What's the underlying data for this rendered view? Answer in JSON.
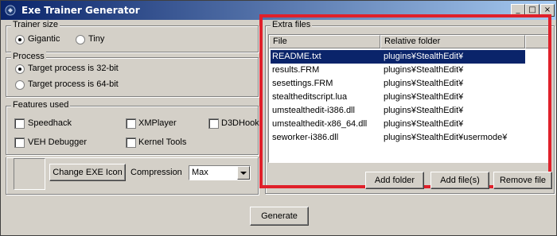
{
  "window": {
    "title": "Exe Trainer Generator"
  },
  "trainer_size": {
    "label": "Trainer size",
    "options": [
      {
        "label": "Gigantic",
        "selected": true
      },
      {
        "label": "Tiny",
        "selected": false
      }
    ]
  },
  "process": {
    "label": "Process",
    "options": [
      {
        "label": "Target process is 32-bit",
        "selected": true
      },
      {
        "label": "Target process is 64-bit",
        "selected": false
      }
    ]
  },
  "features": {
    "label": "Features used",
    "items": [
      {
        "label": "Speedhack",
        "checked": false
      },
      {
        "label": "XMPlayer",
        "checked": false
      },
      {
        "label": "D3DHook",
        "checked": false
      },
      {
        "label": "VEH Debugger",
        "checked": false
      },
      {
        "label": "Kernel Tools",
        "checked": false
      }
    ]
  },
  "icon_area": {
    "change_icon_label": "Change EXE Icon",
    "compression_label": "Compression",
    "compression_value": "Max"
  },
  "extra_files": {
    "label": "Extra files",
    "columns": [
      "File",
      "Relative folder"
    ],
    "rows": [
      {
        "file": "README.txt",
        "folder": "plugins¥StealthEdit¥",
        "selected": true
      },
      {
        "file": "results.FRM",
        "folder": "plugins¥StealthEdit¥",
        "selected": false
      },
      {
        "file": "sesettings.FRM",
        "folder": "plugins¥StealthEdit¥",
        "selected": false
      },
      {
        "file": "stealtheditscript.lua",
        "folder": "plugins¥StealthEdit¥",
        "selected": false
      },
      {
        "file": "umstealthedit-i386.dll",
        "folder": "plugins¥StealthEdit¥",
        "selected": false
      },
      {
        "file": "umstealthedit-x86_64.dll",
        "folder": "plugins¥StealthEdit¥",
        "selected": false
      },
      {
        "file": "seworker-i386.dll",
        "folder": "plugins¥StealthEdit¥usermode¥",
        "selected": false
      }
    ],
    "buttons": {
      "add_folder": "Add folder",
      "add_files": "Add file(s)",
      "remove_file": "Remove file"
    }
  },
  "generate_label": "Generate",
  "colors": {
    "highlight_border": "#e0202a",
    "selection": "#0a246a",
    "face": "#d4d0c8"
  }
}
